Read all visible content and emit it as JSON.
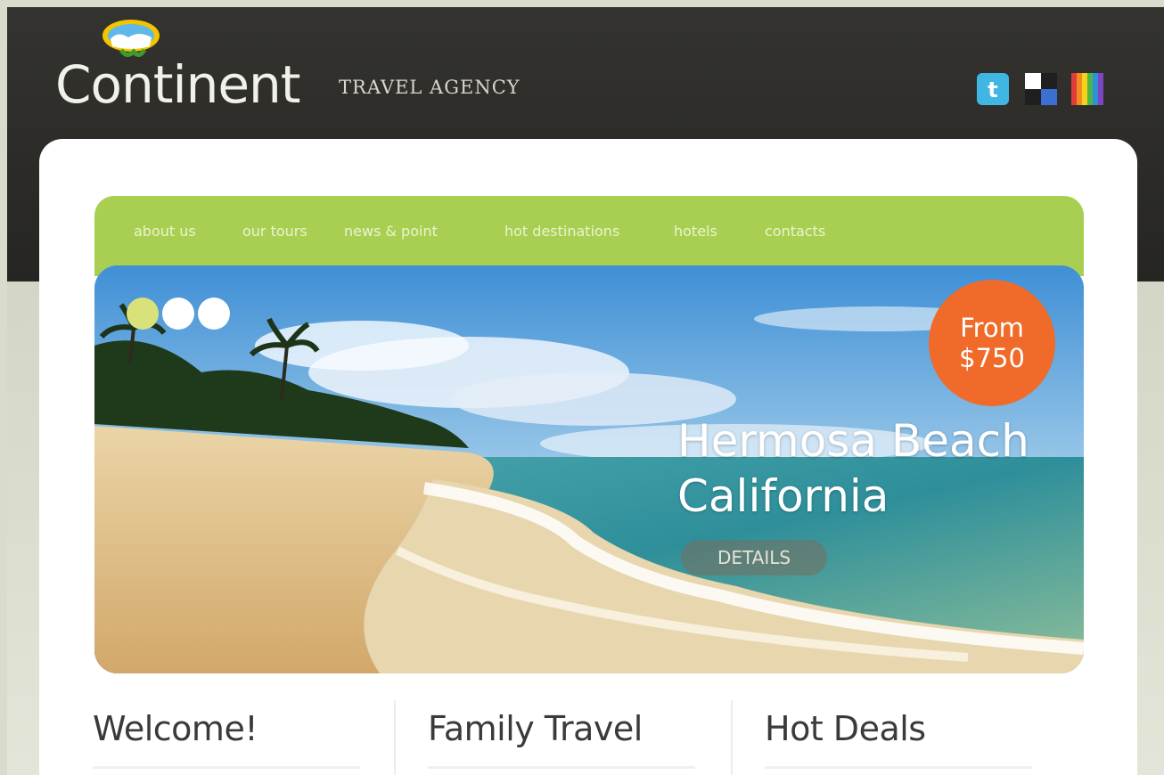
{
  "header": {
    "logo_name": "Continent",
    "tagline": "TRAVEL AGENCY",
    "social_icons": [
      "twitter-icon",
      "delicious-icon",
      "flickr-icon"
    ]
  },
  "nav": {
    "items": [
      "about us",
      "our tours",
      "news & point",
      "hot destinations",
      "hotels",
      "contacts"
    ]
  },
  "hero": {
    "price_line1": "From",
    "price_line2": "$750",
    "title_line1": "Hermosa Beach",
    "title_line2": "California",
    "details_label": "DETAILS",
    "active_slide": 1,
    "slide_count": 3
  },
  "sections": {
    "welcome": "Welcome!",
    "family": "Family Travel",
    "deals": "Hot Deals"
  },
  "colors": {
    "header": "#2e2d29",
    "nav_green": "#a9cf52",
    "badge_orange": "#f06a2a"
  }
}
